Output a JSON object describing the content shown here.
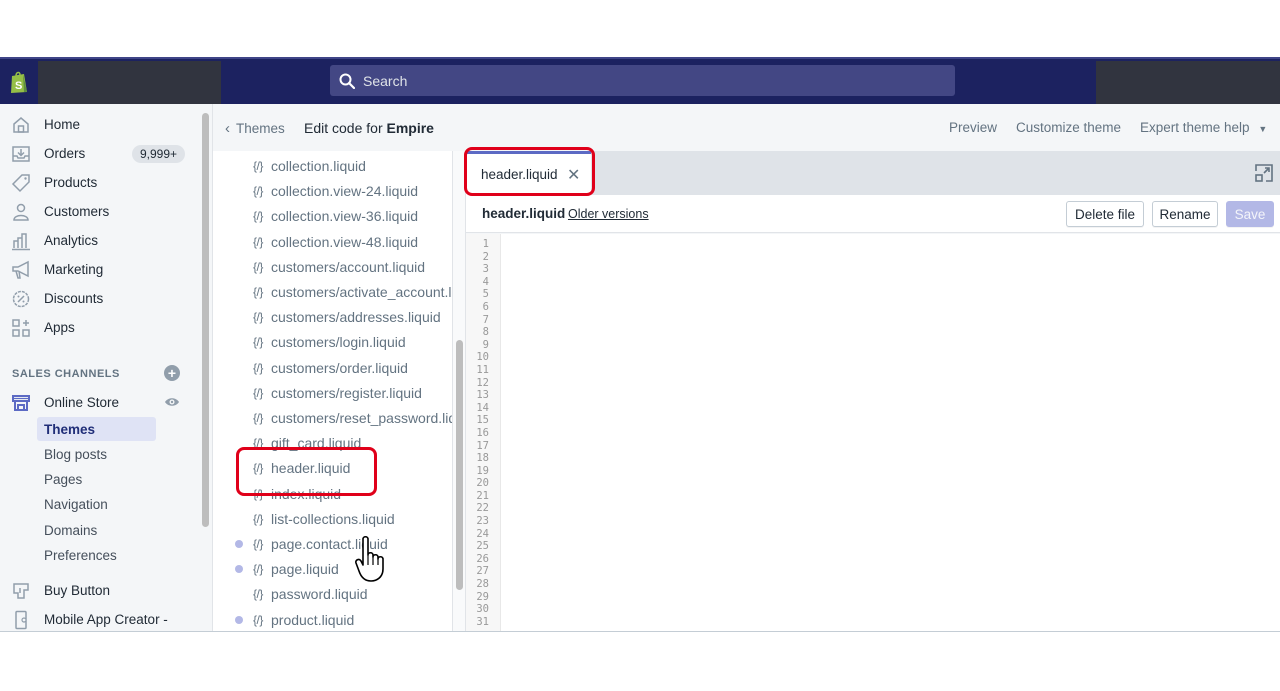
{
  "topbar": {
    "search_placeholder": "Search",
    "colors": {
      "bar": "#1c2260",
      "search": "#434784",
      "accent": "#5c6ac4"
    }
  },
  "sidebar": {
    "items": [
      {
        "label": "Home",
        "icon": "home-icon"
      },
      {
        "label": "Orders",
        "icon": "orders-icon",
        "badge": "9,999+"
      },
      {
        "label": "Products",
        "icon": "tag-icon"
      },
      {
        "label": "Customers",
        "icon": "person-icon"
      },
      {
        "label": "Analytics",
        "icon": "bar-chart-icon"
      },
      {
        "label": "Marketing",
        "icon": "megaphone-icon"
      },
      {
        "label": "Discounts",
        "icon": "discount-icon"
      },
      {
        "label": "Apps",
        "icon": "apps-icon"
      }
    ],
    "sales_channels_title": "SALES CHANNELS",
    "online_store": {
      "label": "Online Store",
      "subitems": [
        {
          "label": "Themes",
          "active": true
        },
        {
          "label": "Blog posts"
        },
        {
          "label": "Pages"
        },
        {
          "label": "Navigation"
        },
        {
          "label": "Domains"
        },
        {
          "label": "Preferences"
        }
      ]
    },
    "channels": [
      {
        "label": "Buy Button",
        "icon": "buy-button-icon"
      },
      {
        "label": "Mobile App Creator -",
        "icon": "mobile-icon"
      }
    ]
  },
  "header": {
    "back_label": "Themes",
    "title_prefix": "Edit code for",
    "theme_name": "Empire",
    "links": [
      "Preview",
      "Customize theme",
      "Expert theme help"
    ]
  },
  "file_list": [
    {
      "name": "collection.liquid",
      "dot": false
    },
    {
      "name": "collection.view-24.liquid",
      "dot": false
    },
    {
      "name": "collection.view-36.liquid",
      "dot": false
    },
    {
      "name": "collection.view-48.liquid",
      "dot": false
    },
    {
      "name": "customers/account.liquid",
      "dot": false
    },
    {
      "name": "customers/activate_account.liquid",
      "dot": false
    },
    {
      "name": "customers/addresses.liquid",
      "dot": false
    },
    {
      "name": "customers/login.liquid",
      "dot": false
    },
    {
      "name": "customers/order.liquid",
      "dot": false
    },
    {
      "name": "customers/register.liquid",
      "dot": false
    },
    {
      "name": "customers/reset_password.liquid",
      "dot": false
    },
    {
      "name": "gift_card.liquid",
      "dot": false
    },
    {
      "name": "header.liquid",
      "dot": false,
      "highlighted": true
    },
    {
      "name": "index.liquid",
      "dot": false
    },
    {
      "name": "list-collections.liquid",
      "dot": false
    },
    {
      "name": "page.contact.liquid",
      "dot": true
    },
    {
      "name": "page.liquid",
      "dot": true
    },
    {
      "name": "password.liquid",
      "dot": false
    },
    {
      "name": "product.liquid",
      "dot": true
    }
  ],
  "file_icon_glyph": "{/}",
  "editor": {
    "open_tab": "header.liquid",
    "file_name": "header.liquid",
    "older_versions": "Older versions",
    "buttons": {
      "delete": "Delete file",
      "rename": "Rename",
      "save": "Save"
    },
    "line_count": 31
  }
}
